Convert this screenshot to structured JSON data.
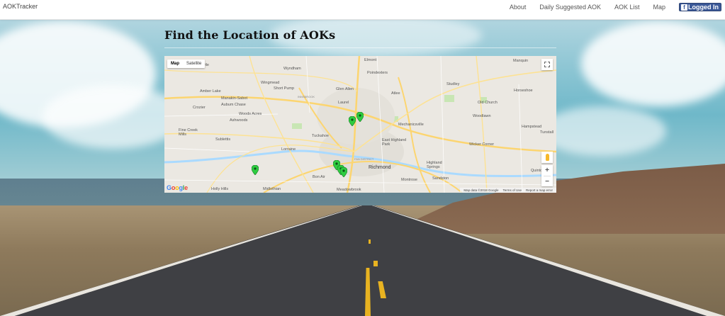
{
  "navbar": {
    "brand": "AOKTracker",
    "links": [
      "About",
      "Daily Suggested AOK",
      "AOK List",
      "Map"
    ],
    "login_label": "Logged In",
    "login_icon": "facebook-icon"
  },
  "page": {
    "title": "Find the Location of AOKs"
  },
  "map": {
    "type_controls": [
      "Map",
      "Satellite"
    ],
    "active_type": "Map",
    "zoom_in": "+",
    "zoom_out": "−",
    "logo": "Google",
    "attribution": [
      "Map data ©2018 Google",
      "Terms of Use",
      "Report a map error"
    ],
    "pin_color": "#2ecc40",
    "marker_count": 6,
    "labels": [
      {
        "name": "Olivile"
      },
      {
        "name": "Wyndham"
      },
      {
        "name": "Elmont"
      },
      {
        "name": "Manquin"
      },
      {
        "name": "Poindexters"
      },
      {
        "name": "Wingmead"
      },
      {
        "name": "Short Pump"
      },
      {
        "name": "Glen Allen"
      },
      {
        "name": "Atlee"
      },
      {
        "name": "Studley"
      },
      {
        "name": "Amber Lake"
      },
      {
        "name": "Manakin-Sabot"
      },
      {
        "name": "INNSBROOK"
      },
      {
        "name": "Horseshoe"
      },
      {
        "name": "Aubum Chase"
      },
      {
        "name": "Laurel"
      },
      {
        "name": "Old Church"
      },
      {
        "name": "Crozier"
      },
      {
        "name": "Woods Acres"
      },
      {
        "name": "Ashwoods"
      },
      {
        "name": "Woodlawn"
      },
      {
        "name": "Mechanicsville"
      },
      {
        "name": "Fine Creek Mills"
      },
      {
        "name": "Tuckahoe"
      },
      {
        "name": "Hampstead"
      },
      {
        "name": "Tunstall"
      },
      {
        "name": "Sublettis"
      },
      {
        "name": "East Highland Park"
      },
      {
        "name": "Wicker Corner"
      },
      {
        "name": "Lorraine"
      },
      {
        "name": "FAN DISTRICT"
      },
      {
        "name": "Richmond"
      },
      {
        "name": "Highland Springs"
      },
      {
        "name": "Quinton"
      },
      {
        "name": "Bon Air"
      },
      {
        "name": "Montrose"
      },
      {
        "name": "Sandston"
      },
      {
        "name": "Holly Hills"
      },
      {
        "name": "Midlothian"
      },
      {
        "name": "Meadowbrook"
      }
    ]
  }
}
